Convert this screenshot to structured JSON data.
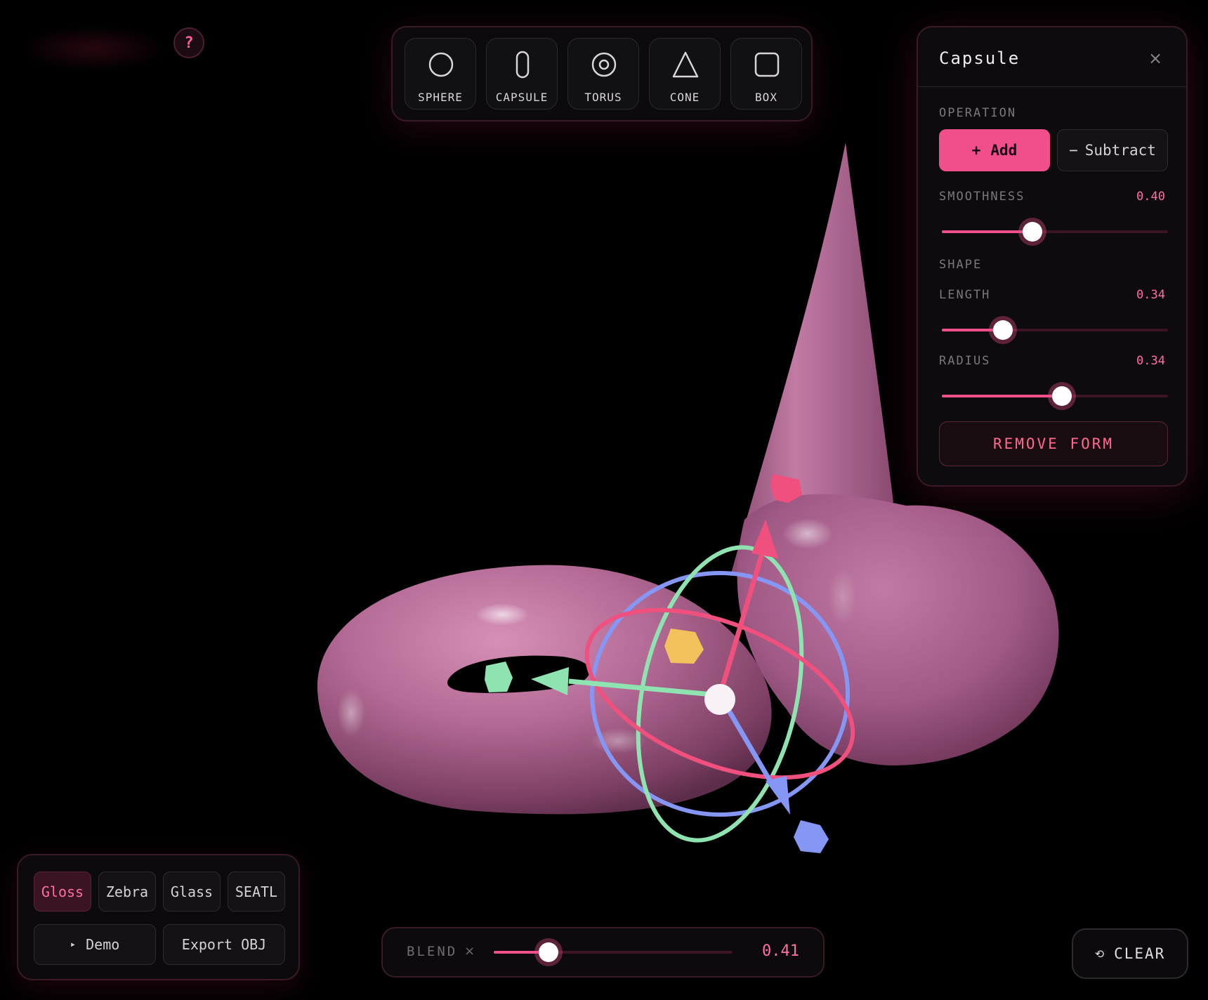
{
  "help": {
    "label": "?"
  },
  "toolbar": {
    "tools": [
      {
        "label": "SPHERE",
        "icon": "circle-icon"
      },
      {
        "label": "CAPSULE",
        "icon": "capsule-icon"
      },
      {
        "label": "TORUS",
        "icon": "torus-icon"
      },
      {
        "label": "CONE",
        "icon": "triangle-icon"
      },
      {
        "label": "BOX",
        "icon": "square-icon"
      }
    ]
  },
  "panel": {
    "title": "Capsule",
    "close": "×",
    "operation_label": "OPERATION",
    "add_icon": "+",
    "add_label": "Add",
    "subtract_icon": "−",
    "subtract_label": "Subtract",
    "smoothness": {
      "label": "SMOOTHNESS",
      "value": "0.40",
      "level": 0.4
    },
    "shape_label": "SHAPE",
    "length": {
      "label": "LENGTH",
      "value": "0.34",
      "level": 0.27
    },
    "radius": {
      "label": "RADIUS",
      "value": "0.34",
      "level": 0.53
    },
    "remove_label": "REMOVE FORM"
  },
  "materials": {
    "items": [
      "Gloss",
      "Zebra",
      "Glass",
      "SEATL"
    ],
    "active": "Gloss",
    "demo_icon": "▸",
    "demo_label": "Demo",
    "export_label": "Export OBJ"
  },
  "blend": {
    "label": "BLEND",
    "x": "×",
    "value": "0.41",
    "level": 0.23
  },
  "clear": {
    "icon": "⟲",
    "label": "CLEAR"
  },
  "colors": {
    "accent": "#f04f8b",
    "shape": "#b06590",
    "gizmo_red": "#f0507e",
    "gizmo_green": "#8fe3b0",
    "gizmo_blue": "#8596f5",
    "gizmo_yellow": "#f3c25c"
  }
}
